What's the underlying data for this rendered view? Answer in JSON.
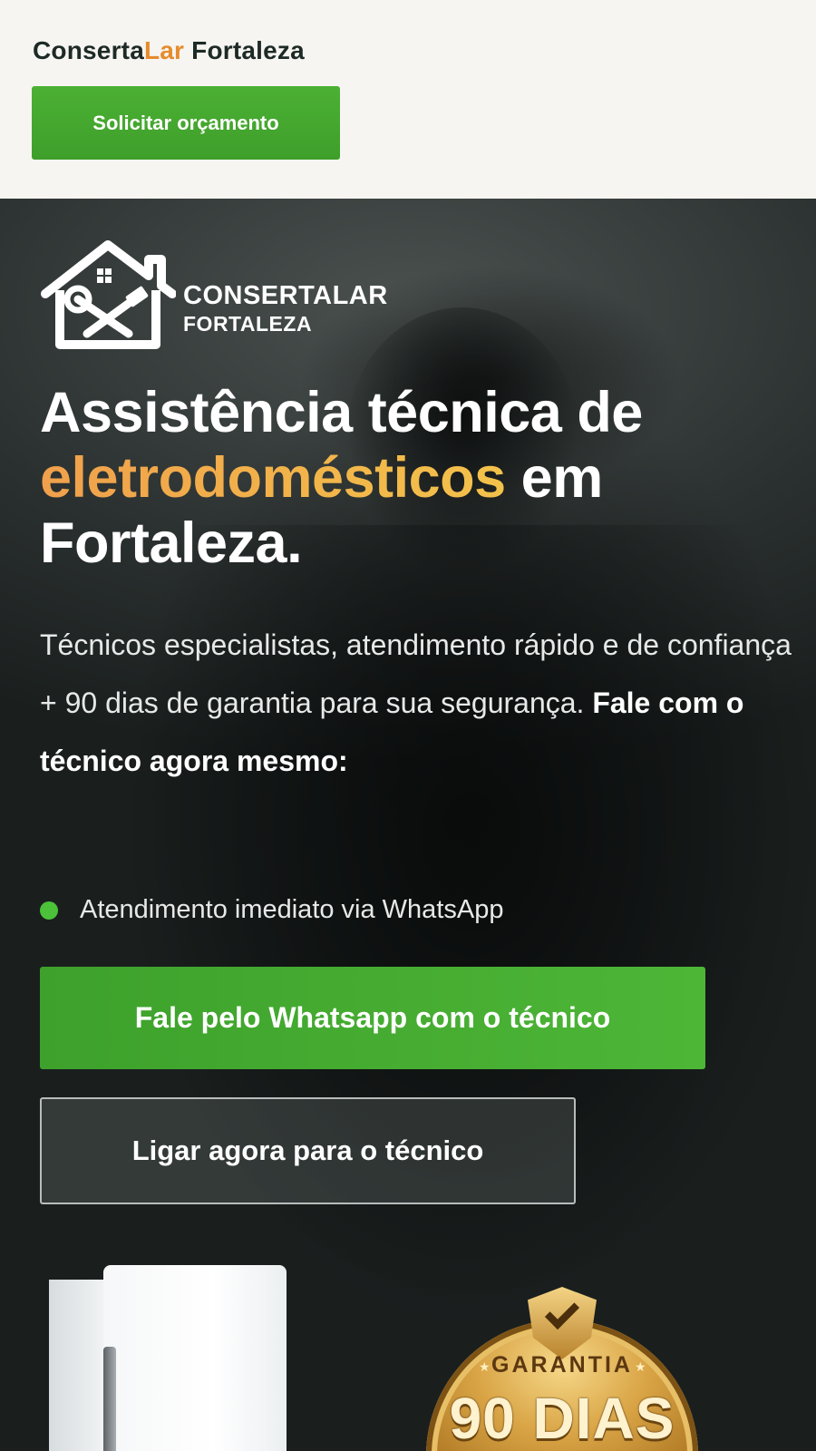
{
  "header": {
    "brand_part1": "Conserta",
    "brand_part2": "Lar",
    "brand_part3": " Fortaleza",
    "quote_button": "Solicitar orçamento"
  },
  "hero": {
    "logo_line1": "CONSERTALAR",
    "logo_line2": "FORTALEZA",
    "headline_part1": "Assistência técnica de ",
    "headline_highlight": "eletrodomésticos",
    "headline_part2": " em Fortaleza.",
    "subtitle_plain": "Técnicos especialistas, atendimento rápido e de confiança + 90 dias de garantia para sua segurança. ",
    "subtitle_bold": "Fale com o técnico agora mesmo:",
    "status_text": "Atendimento imediato via WhatsApp",
    "whatsapp_button": "Fale pelo Whatsapp com o técnico",
    "call_button": "Ligar agora para o técnico",
    "badge_label": "GARANTIA",
    "badge_days": "90 DIAS"
  },
  "colors": {
    "accent_orange": "#e58c2e",
    "primary_green": "#4cb034",
    "status_green": "#4cc13a"
  },
  "icons": {
    "logo": "house-tools-icon",
    "badge": "guarantee-shield-icon"
  }
}
